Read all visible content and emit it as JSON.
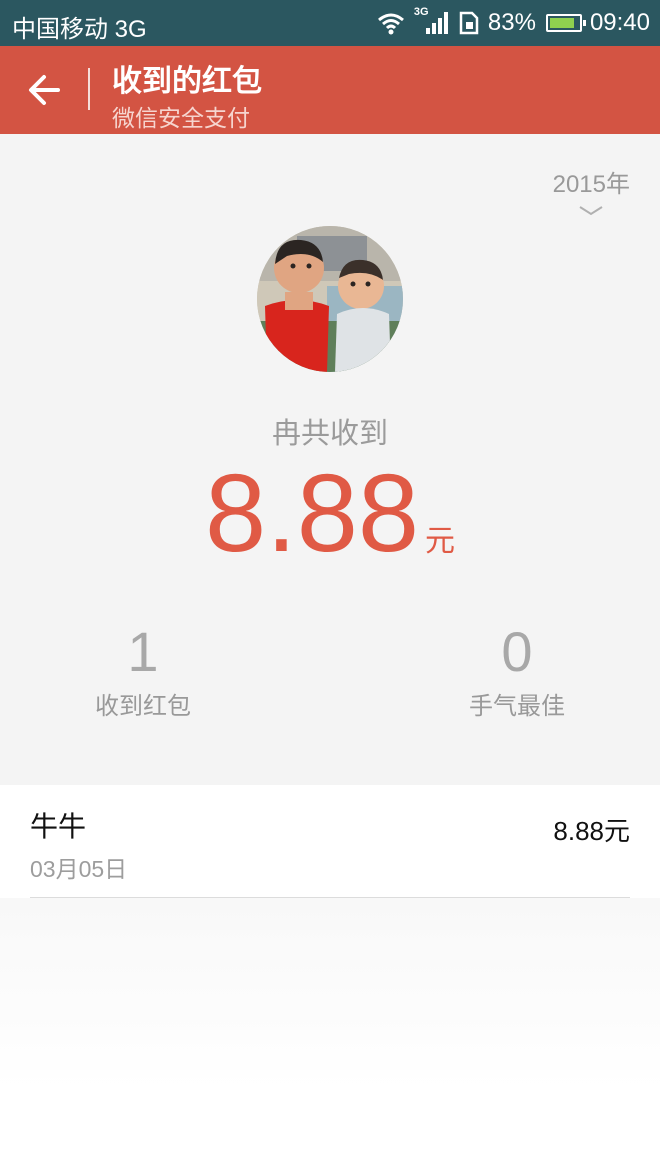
{
  "status_bar": {
    "carrier": "中国移动 3G",
    "network": "3G",
    "battery": "83%",
    "time": "09:40"
  },
  "header": {
    "title": "收到的红包",
    "subtitle": "微信安全支付",
    "back_icon": "arrow-left-icon"
  },
  "summary": {
    "year": "2015年",
    "total_label": "冉共收到",
    "total_amount": "8.88",
    "currency_unit": "元",
    "received_count": "1",
    "received_label": "收到红包",
    "best_luck_count": "0",
    "best_luck_label": "手气最佳"
  },
  "records": [
    {
      "name": "牛牛",
      "date": "03月05日",
      "amount": "8.88元"
    }
  ],
  "colors": {
    "status_bar": "#2b5760",
    "header": "#d35443",
    "amount": "#e05a45",
    "summary_bg": "#f4f4f4"
  }
}
